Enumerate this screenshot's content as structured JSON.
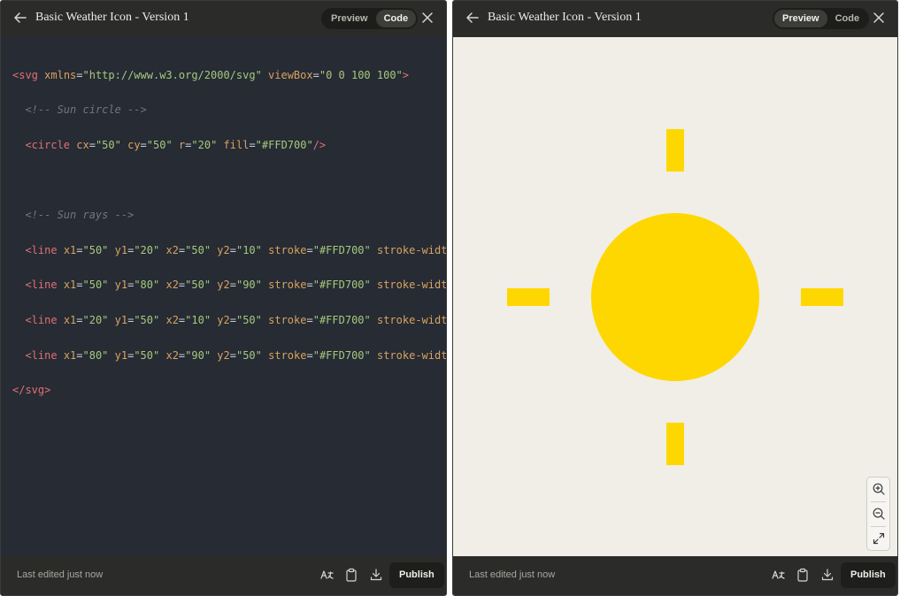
{
  "artifact": {
    "title": "Basic Weather Icon - Version 1"
  },
  "view_toggle": {
    "preview_label": "Preview",
    "code_label": "Code"
  },
  "code_view": {
    "line1": {
      "open": "<svg",
      "a1": "xmlns",
      "v1": "\"http://www.w3.org/2000/svg\"",
      "a2": "viewBox",
      "v2": "\"0 0 100 100\"",
      "close": ">"
    },
    "line2": {
      "comment": "<!-- Sun circle -->"
    },
    "line3": {
      "open": "<circle",
      "a1": "cx",
      "v1": "\"50\"",
      "a2": "cy",
      "v2": "\"50\"",
      "a3": "r",
      "v3": "\"20\"",
      "a4": "fill",
      "v4": "\"#FFD700\"",
      "close": "/>"
    },
    "line5": {
      "comment": "<!-- Sun rays -->"
    },
    "rays": [
      {
        "open": "<line",
        "a1": "x1",
        "v1": "\"50\"",
        "a2": "y1",
        "v2": "\"20\"",
        "a3": "x2",
        "v3": "\"50\"",
        "a4": "y2",
        "v4": "\"10\"",
        "a5": "stroke",
        "v5": "\"#FFD700\"",
        "a6": "stroke-width",
        "v6": "\""
      },
      {
        "open": "<line",
        "a1": "x1",
        "v1": "\"50\"",
        "a2": "y1",
        "v2": "\"80\"",
        "a3": "x2",
        "v3": "\"50\"",
        "a4": "y2",
        "v4": "\"90\"",
        "a5": "stroke",
        "v5": "\"#FFD700\"",
        "a6": "stroke-width",
        "v6": "\""
      },
      {
        "open": "<line",
        "a1": "x1",
        "v1": "\"20\"",
        "a2": "y1",
        "v2": "\"50\"",
        "a3": "x2",
        "v3": "\"10\"",
        "a4": "y2",
        "v4": "\"50\"",
        "a5": "stroke",
        "v5": "\"#FFD700\"",
        "a6": "stroke-width",
        "v6": "\""
      },
      {
        "open": "<line",
        "a1": "x1",
        "v1": "\"80\"",
        "a2": "y1",
        "v2": "\"50\"",
        "a3": "x2",
        "v3": "\"90\"",
        "a4": "y2",
        "v4": "\"50\"",
        "a5": "stroke",
        "v5": "\"#FFD700\"",
        "a6": "stroke-width",
        "v6": "\""
      }
    ],
    "end": {
      "close": "</svg>"
    }
  },
  "preview_graphic": {
    "fill_color": "#FFD700",
    "background": "#f0eee6"
  },
  "footer": {
    "status": "Last edited just now",
    "publish_label": "Publish"
  },
  "icons": {
    "back": "arrow-left-icon",
    "close": "close-icon",
    "translate": "translate-icon",
    "copy": "clipboard-icon",
    "download": "download-icon",
    "zoom_in": "zoom-in-icon",
    "zoom_out": "zoom-out-icon",
    "fit": "expand-icon"
  }
}
